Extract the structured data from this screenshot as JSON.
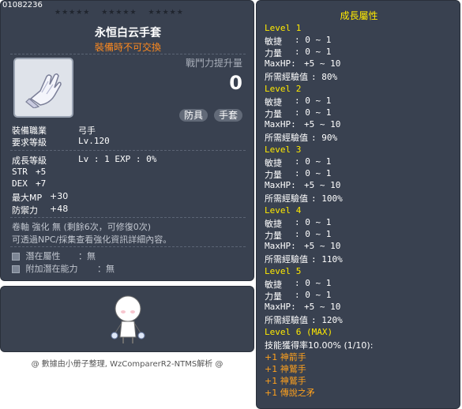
{
  "item": {
    "id": "01082236",
    "stars_a": "★★★★★",
    "stars_b": "★★★★★",
    "stars_c": "★★★★★",
    "name": "永恒白云手套",
    "sub": "裝備時不可交換",
    "power_label": "戰鬥力提升量",
    "power_value": "0",
    "chip1": "防具",
    "chip2": "手套"
  },
  "req": {
    "job_label": "裝備職業",
    "job_value": "弓手",
    "level_label": "要求等級",
    "level_value": "Lv.120"
  },
  "growth": {
    "label": "成長等級",
    "value": "Lv : 1  EXP : 0%"
  },
  "stats": [
    {
      "label": "STR",
      "value": "+5"
    },
    {
      "label": "DEX",
      "value": "+7"
    },
    {
      "label": "最大MP",
      "value": "+30"
    },
    {
      "label": "防禦力",
      "value": "+48"
    }
  ],
  "scroll": {
    "line1": "卷軸 強化 無 (剩餘6次，可修復0次)",
    "line2": "可透過NPC/採集查看強化資訊詳細內容。"
  },
  "potential": {
    "label1": "潛在屬性",
    "value1": "：無",
    "label2": "附加潛在能力",
    "value2": "：無"
  },
  "footer": "@ 數據由小册子整理, WzComparerR2-NTMS解析 @",
  "side": {
    "title": "成長屬性",
    "labels": {
      "dex": "敏捷",
      "str": "力量",
      "hp": "MaxHP:",
      "exp": "所需經驗值"
    },
    "levels": [
      {
        "title": "Level 1",
        "dex": ": 0 ~ 1",
        "str": ": 0 ~ 1",
        "hp": "+5 ~ 10",
        "exp": ": 80%"
      },
      {
        "title": "Level 2",
        "dex": ": 0 ~ 1",
        "str": ": 0 ~ 1",
        "hp": "+5 ~ 10",
        "exp": ": 90%"
      },
      {
        "title": "Level 3",
        "dex": ": 0 ~ 1",
        "str": ": 0 ~ 1",
        "hp": "+5 ~ 10",
        "exp": ": 100%"
      },
      {
        "title": "Level 4",
        "dex": ": 0 ~ 1",
        "str": ": 0 ~ 1",
        "hp": "+5 ~ 10",
        "exp": ": 110%"
      },
      {
        "title": "Level 5",
        "dex": ": 0 ~ 1",
        "str": ": 0 ~ 1",
        "hp": "+5 ~ 10",
        "exp": ": 120%"
      }
    ],
    "level6": {
      "title": "Level 6 (MAX)",
      "rate": "技能獲得率10.00% (1/10):",
      "skills": [
        "+1 神箭手",
        "+1 神鷲手",
        "+1 神鷲手",
        "+1 傳說之矛"
      ]
    }
  },
  "colors": {
    "panel": "#394150",
    "title": "#ffea00",
    "notice": "#ff8a1e"
  }
}
